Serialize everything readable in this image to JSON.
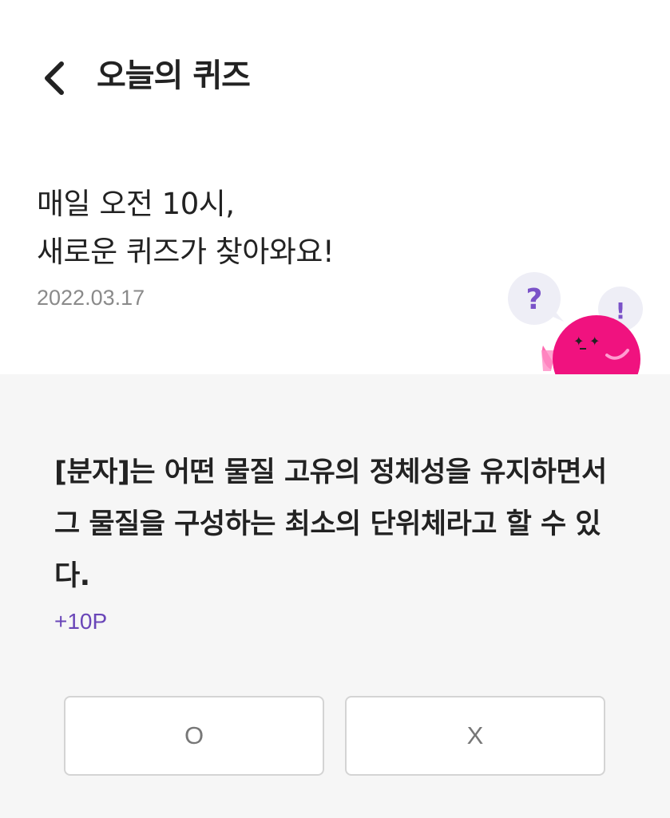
{
  "header": {
    "title": "오늘의 퀴즈",
    "back_icon": "chevron-left-icon"
  },
  "intro": {
    "line1": "매일 오전 10시,",
    "line2": "새로운 퀴즈가 찾아와요!",
    "date": "2022.03.17"
  },
  "mascot": {
    "question_mark": "?",
    "exclamation_mark": "!",
    "body_color": "#f0127f",
    "bubble_color": "#eeeef6",
    "mark_color": "#7a52c8"
  },
  "quiz": {
    "question": "[분자]는 어떤 물질 고유의 정체성을 유지하면서 그 물질을 구성하는 최소의 단위체라고 할 수 있다.",
    "points": "+10P",
    "options": [
      {
        "label": "O"
      },
      {
        "label": "X"
      }
    ]
  },
  "colors": {
    "accent": "#6a46b8",
    "panel_background": "#f6f6f6",
    "button_border": "#d4d4d4"
  }
}
